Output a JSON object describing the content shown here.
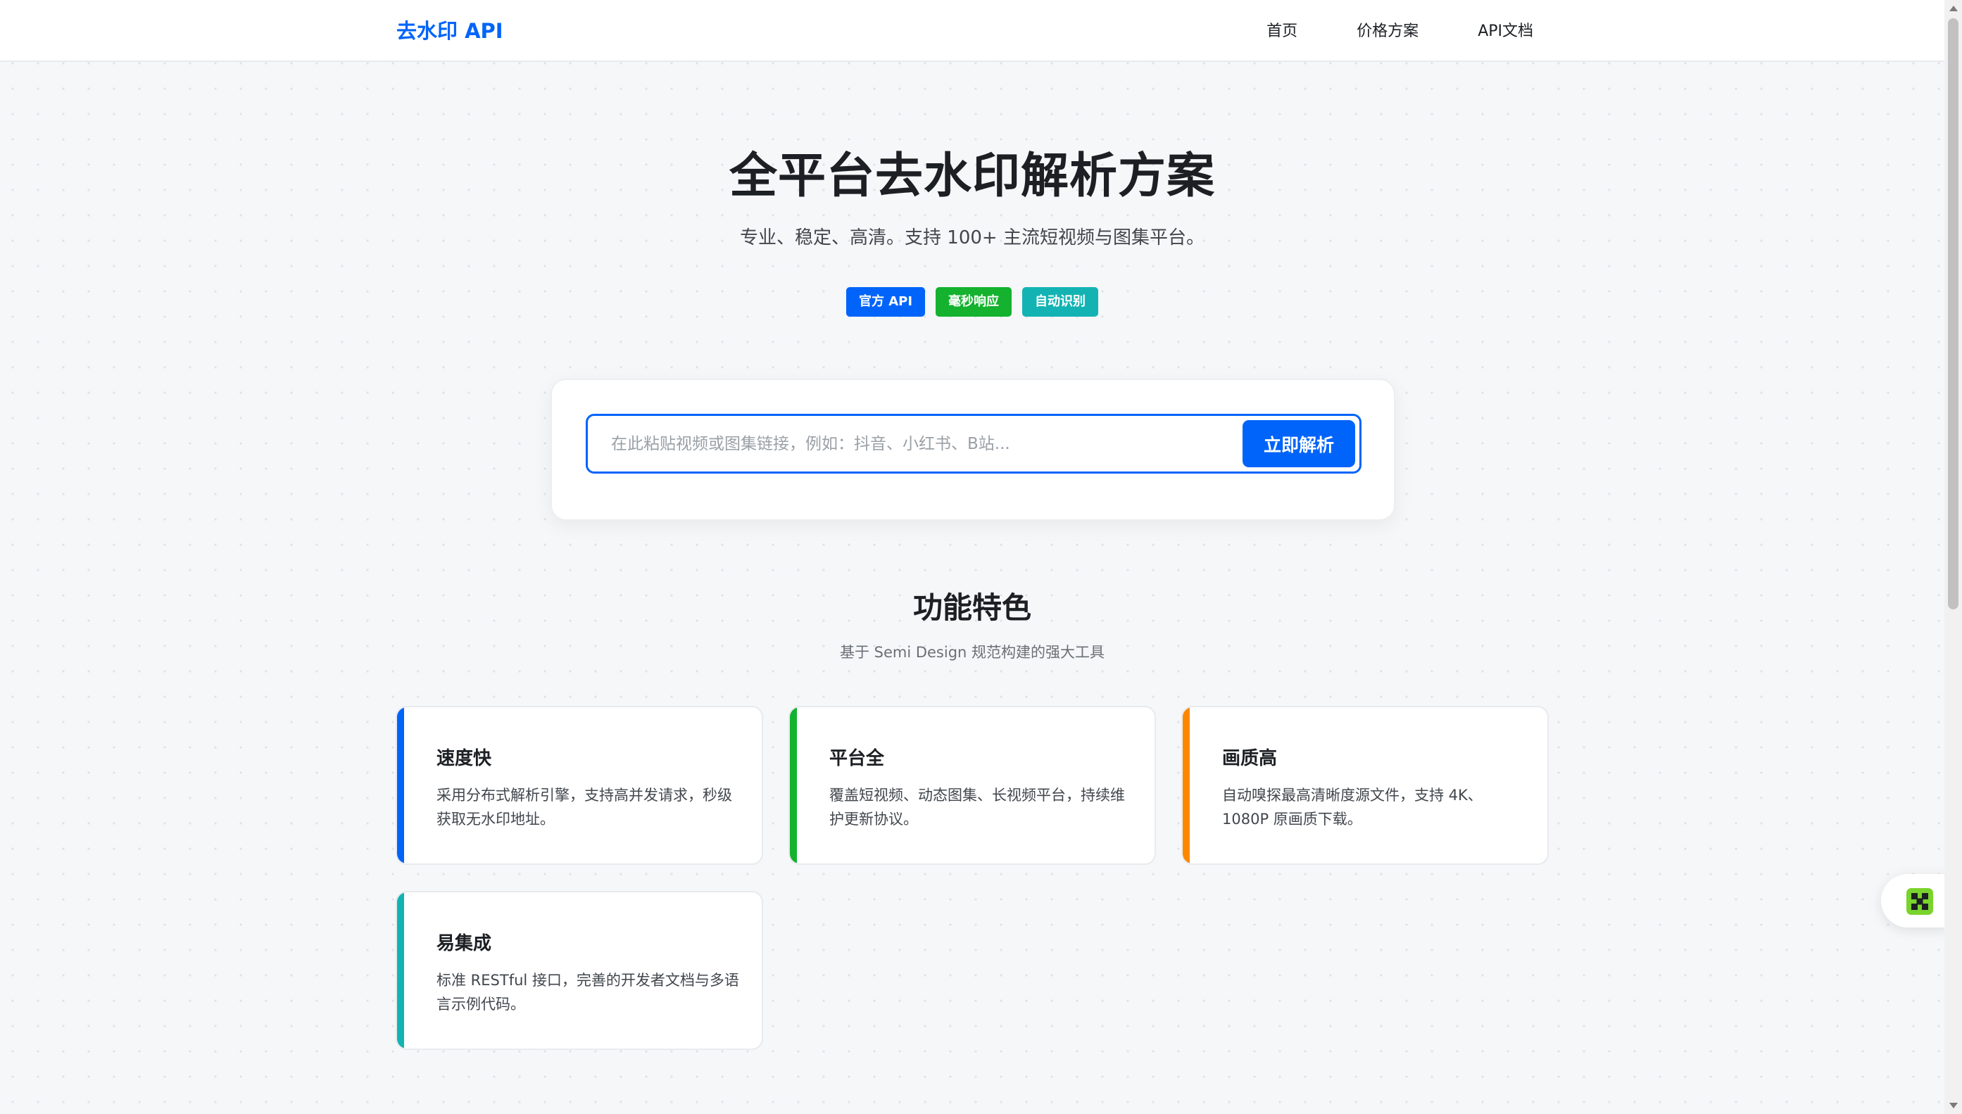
{
  "header": {
    "logo": "去水印 API",
    "nav": [
      {
        "label": "首页"
      },
      {
        "label": "价格方案"
      },
      {
        "label": "API文档"
      }
    ]
  },
  "hero": {
    "title": "全平台去水印解析方案",
    "subtitle": "专业、稳定、高清。支持 100+ 主流短视频与图集平台。",
    "tags": [
      {
        "label": "官方 API",
        "color": "#0064fa"
      },
      {
        "label": "毫秒响应",
        "color": "#14b22e"
      },
      {
        "label": "自动识别",
        "color": "#14b3b3"
      }
    ]
  },
  "search": {
    "placeholder": "在此粘贴视频或图集链接，例如：抖音、小红书、B站...",
    "value": "",
    "button_label": "立即解析"
  },
  "features": {
    "title": "功能特色",
    "subtitle": "基于 Semi Design 规范构建的强大工具",
    "cards": [
      {
        "title": "速度快",
        "desc": "采用分布式解析引擎，支持高并发请求，秒级获取无水印地址。",
        "accent": "#0064fa"
      },
      {
        "title": "平台全",
        "desc": "覆盖短视频、动态图集、长视频平台，持续维护更新协议。",
        "accent": "#14b22e"
      },
      {
        "title": "画质高",
        "desc": "自动嗅探最高清晰度源文件，支持 4K、1080P 原画质下载。",
        "accent": "#fc8800"
      },
      {
        "title": "易集成",
        "desc": "标准 RESTful 接口，完善的开发者文档与多语言示例代码。",
        "accent": "#14b3b3"
      }
    ]
  },
  "widget": {
    "icon": "app-widget-icon",
    "color": "#7ad32d"
  },
  "colors": {
    "brand": "#0064fa",
    "background": "#f6f7f9"
  }
}
